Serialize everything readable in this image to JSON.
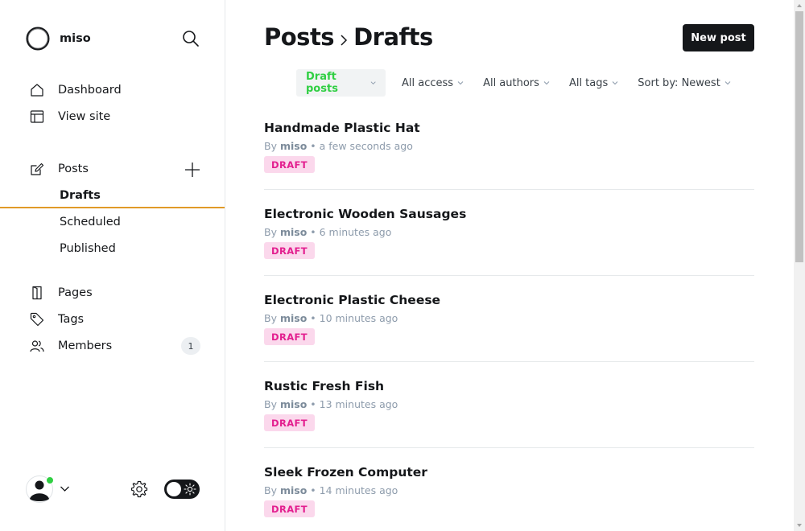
{
  "brand": {
    "name": "miso"
  },
  "sidebar": {
    "items": [
      {
        "label": "Dashboard",
        "icon": "house-icon"
      },
      {
        "label": "View site",
        "icon": "layout-icon"
      },
      {
        "label": "Posts",
        "icon": "edit-icon"
      },
      {
        "label": "Pages",
        "icon": "page-icon"
      },
      {
        "label": "Tags",
        "icon": "tag-icon"
      },
      {
        "label": "Members",
        "icon": "members-icon",
        "badge": "1"
      }
    ],
    "posts_sub": [
      {
        "label": "Drafts",
        "active": true
      },
      {
        "label": "Scheduled"
      },
      {
        "label": "Published"
      }
    ]
  },
  "header": {
    "breadcrumb_root": "Posts",
    "breadcrumb_current": "Drafts",
    "new_post_label": "New post"
  },
  "filters": {
    "type": "Draft posts",
    "access": "All access",
    "authors": "All authors",
    "tags": "All tags",
    "sort": "Sort by: Newest"
  },
  "posts": [
    {
      "title": "Handmade Plastic Hat",
      "by": "By ",
      "author": "miso",
      "time": " • a few seconds ago",
      "status": "DRAFT"
    },
    {
      "title": "Electronic Wooden Sausages",
      "by": "By ",
      "author": "miso",
      "time": " • 6 minutes ago",
      "status": "DRAFT"
    },
    {
      "title": "Electronic Plastic Cheese",
      "by": "By ",
      "author": "miso",
      "time": " • 10 minutes ago",
      "status": "DRAFT"
    },
    {
      "title": "Rustic Fresh Fish",
      "by": "By ",
      "author": "miso",
      "time": " • 13 minutes ago",
      "status": "DRAFT"
    },
    {
      "title": "Sleek Frozen Computer",
      "by": "By ",
      "author": "miso",
      "time": " • 14 minutes ago",
      "status": "DRAFT"
    }
  ],
  "colors": {
    "accent_green": "#30cf43",
    "draft_pink": "#e31f8f",
    "active_underline": "#e19a28",
    "primary_button": "#15171a"
  }
}
